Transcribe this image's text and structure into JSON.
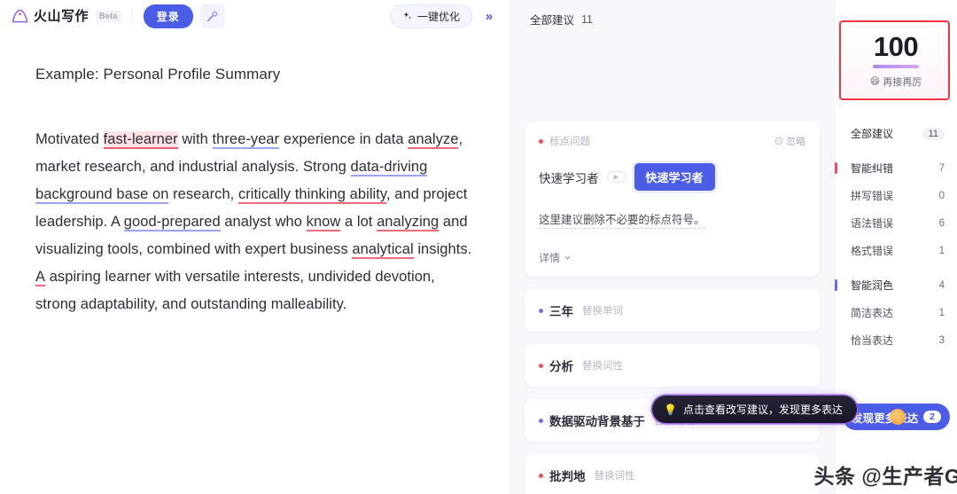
{
  "topbar": {
    "brand_name": "火山写作",
    "beta": "Beta",
    "login_label": "登录",
    "wand_icon": "magic-wand-icon",
    "optimize_label": "一键优化",
    "sparkle_icon": "sparkle-icon",
    "collapse_label": "»"
  },
  "document": {
    "title": "Example: Personal Profile Summary",
    "paragraph": {
      "s1": "Motivated ",
      "m1": "fast-learner",
      "s2": " with ",
      "m2": "three-year",
      "s3": " experience in data ",
      "m3": "analyze",
      "s4": ", market research, and industrial analysis. Strong ",
      "m4": "data-driving background base on",
      "s5": " research, ",
      "m5": "critically thinking ability",
      "s6": ", and project leadership. A ",
      "m6": "good-prepared",
      "s7": " analyst who ",
      "m7": "know",
      "s8": " a lot ",
      "m8": "analyzing",
      "s9": " and visualizing tools, combined with expert business ",
      "m9": "analytical",
      "s10": " insights. ",
      "m10": "A",
      "s11": " aspiring learner with versatile interests, undivided devotion, strong adaptability, and outstanding malleability."
    }
  },
  "suggestions": {
    "header_label": "全部建议",
    "header_count": "11",
    "card": {
      "type_label": "标点问题",
      "ignore_label": "忽略",
      "ignore_icon": "ignore-circle-icon",
      "from_text": "快速学习者",
      "arrow_icon": "arrow-right-icon",
      "to_text": "快速学习者",
      "description": "这里建议删除不必要的标点符号。",
      "detail_label": "详情",
      "detail_icon": "chevron-down-icon"
    },
    "items": [
      {
        "word": "三年",
        "tag": "替换单词",
        "dot": "purple"
      },
      {
        "word": "分析",
        "tag": "替换词性",
        "dot": "red"
      },
      {
        "word": "数据驱动背景基于",
        "tag": "替换短语",
        "dot": "purple"
      },
      {
        "word": "批判地",
        "tag": "替换词性",
        "dot": "red"
      }
    ],
    "tooltip": {
      "icon": "lightbulb-icon",
      "text": "点击查看改写建议，发现更多表达"
    }
  },
  "watermark": "头条 @生产者Glen",
  "sidebar": {
    "score": {
      "value": "100",
      "emoji": "😄",
      "label": "再接再厉"
    },
    "rows": [
      {
        "label": "全部建议",
        "value": "11",
        "style": "pill",
        "accent": "none",
        "group": false
      },
      {
        "label": "智能纠错",
        "value": "7",
        "style": "plain",
        "accent": "red",
        "group": true
      },
      {
        "label": "拼写错误",
        "value": "0",
        "style": "plain",
        "accent": "none",
        "group": false
      },
      {
        "label": "语法错误",
        "value": "6",
        "style": "plain",
        "accent": "none",
        "group": false
      },
      {
        "label": "格式错误",
        "value": "1",
        "style": "plain",
        "accent": "none",
        "group": false
      },
      {
        "label": "智能润色",
        "value": "4",
        "style": "plain",
        "accent": "purple",
        "group": true
      },
      {
        "label": "简洁表达",
        "value": "1",
        "style": "plain",
        "accent": "none",
        "group": false
      },
      {
        "label": "恰当表达",
        "value": "3",
        "style": "plain",
        "accent": "none",
        "group": false
      }
    ],
    "discover": {
      "label": "发现更多表达",
      "badge": "2"
    }
  },
  "colors": {
    "brand_blue": "#4b5ce6",
    "error_red": "#ef4f62",
    "polish_purple": "#6f6ee8",
    "highlight_box": "#f5333f"
  }
}
